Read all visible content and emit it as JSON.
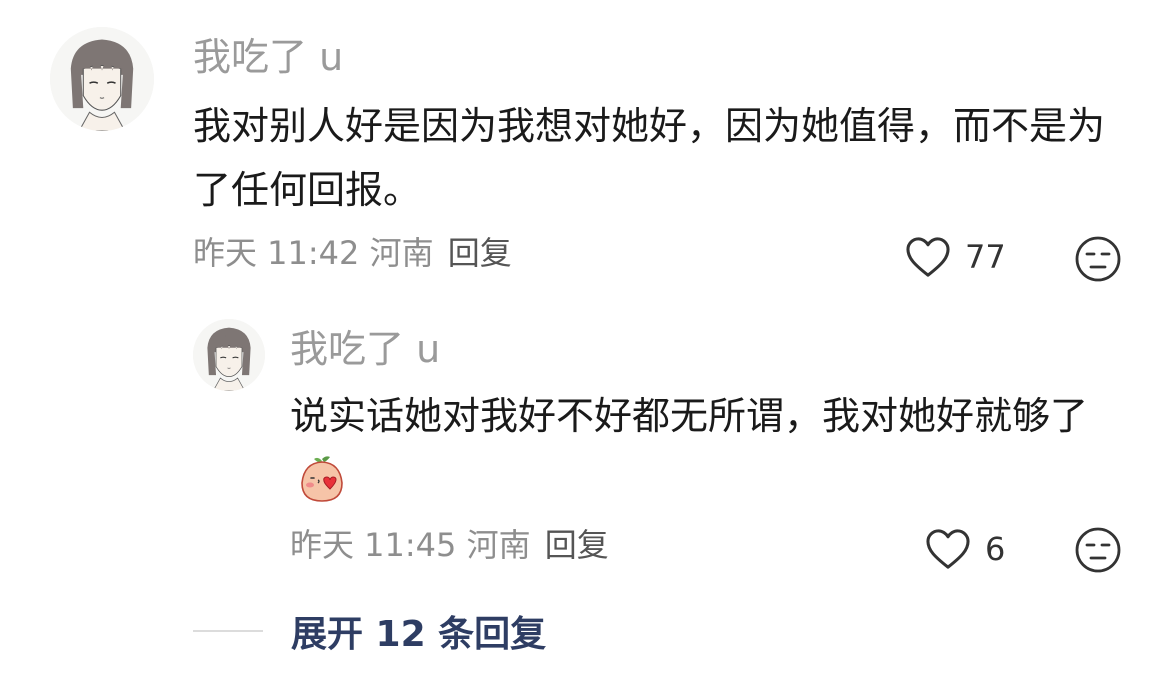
{
  "comments": [
    {
      "username": "我吃了 u",
      "content": "我对别人好是因为我想对她好，因为她值得，而不是为了任何回报。",
      "time": "昨天 11:42",
      "location": "河南",
      "reply_label": "回复",
      "likes": "77"
    },
    {
      "username": "我吃了 u",
      "content": "说实话她对我好不好都无所谓，我对她好就够了",
      "emoji": "blowing-kiss-peach-emoji",
      "time": "昨天 11:45",
      "location": "河南",
      "reply_label": "回复",
      "likes": "6"
    }
  ],
  "expand_replies": "展开 12 条回复",
  "colors": {
    "username": "#9a9a9a",
    "meta": "#8e8e8e",
    "expand": "#2e3d63"
  },
  "icons": [
    "avatar-anime-girl-icon",
    "heart-outline-icon",
    "unamused-face-icon",
    "blowing-kiss-peach-emoji"
  ]
}
